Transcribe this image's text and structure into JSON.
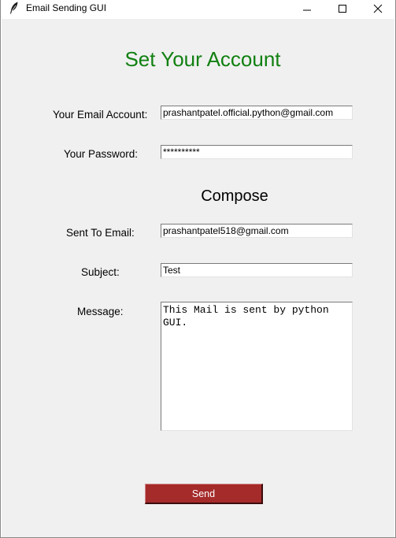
{
  "window": {
    "title": "Email Sending GUI",
    "controls": {
      "minimize_icon": "minimize-icon",
      "maximize_icon": "maximize-icon",
      "close_icon": "close-icon"
    },
    "app_icon": "feather-icon"
  },
  "form": {
    "heading": "Set Your Account",
    "heading_color": "#118011",
    "email_label": "Your Email Account:",
    "email_value": "prashantpatel.official.python@gmail.com",
    "password_label": "Your Password:",
    "password_value": "**********",
    "compose_heading": "Compose",
    "to_label": "Sent To Email:",
    "to_value": "prashantpatel518@gmail.com",
    "subject_label": "Subject:",
    "subject_value": "Test",
    "message_label": "Message:",
    "message_value": "This Mail is sent by python GUI.",
    "send_label": "Send",
    "send_color": "#a52a2a"
  }
}
